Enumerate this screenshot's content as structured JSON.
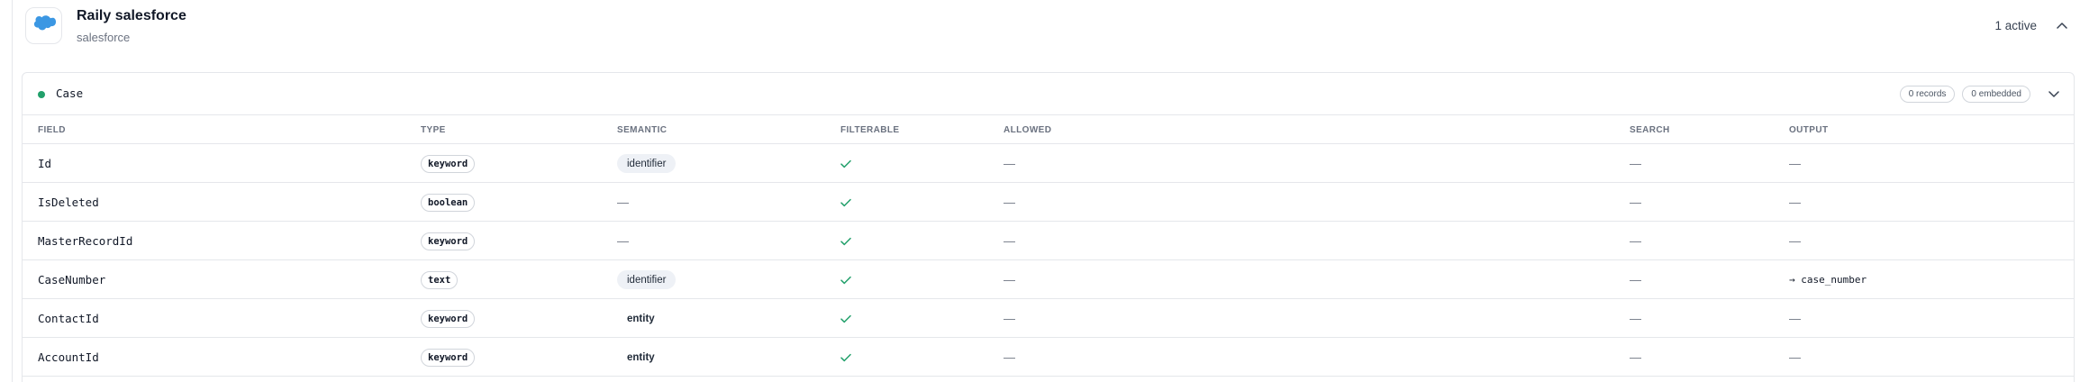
{
  "integration": {
    "title": "Raily salesforce",
    "subtitle": "salesforce",
    "active_count": "1 active",
    "logo_icon": "salesforce-cloud-icon",
    "brand_color": "#3b97e3"
  },
  "object": {
    "name": "Case",
    "status_color": "#22a06b",
    "records": "0 records",
    "embedded": "0 embedded"
  },
  "table": {
    "headers": {
      "field": "FIELD",
      "type": "TYPE",
      "semantic": "SEMANTIC",
      "filterable": "FILTERABLE",
      "allowed": "ALLOWED",
      "search": "SEARCH",
      "output": "OUTPUT"
    },
    "rows": [
      {
        "field": "Id",
        "type": "keyword",
        "semantic": "identifier",
        "filterable": true,
        "allowed": "—",
        "search": "—",
        "output": "—"
      },
      {
        "field": "IsDeleted",
        "type": "boolean",
        "semantic": "—",
        "filterable": true,
        "allowed": "—",
        "search": "—",
        "output": "—"
      },
      {
        "field": "MasterRecordId",
        "type": "keyword",
        "semantic": "—",
        "filterable": true,
        "allowed": "—",
        "search": "—",
        "output": "—"
      },
      {
        "field": "CaseNumber",
        "type": "text",
        "semantic": "identifier",
        "filterable": true,
        "allowed": "—",
        "search": "—",
        "output": "→ case_number"
      },
      {
        "field": "ContactId",
        "type": "keyword",
        "semantic": "entity",
        "filterable": true,
        "allowed": "—",
        "search": "—",
        "output": "—"
      },
      {
        "field": "AccountId",
        "type": "keyword",
        "semantic": "entity",
        "filterable": true,
        "allowed": "—",
        "search": "—",
        "output": "—"
      }
    ]
  },
  "colors": {
    "check": "#22a06b",
    "border": "#e5e7eb",
    "semantic_pill_bg": "#eef1f6"
  }
}
